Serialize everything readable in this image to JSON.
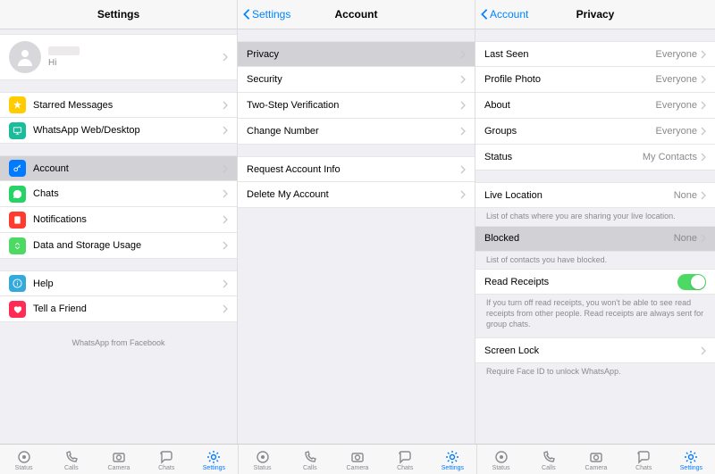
{
  "colors": {
    "accent": "#007aff",
    "whatsapp": "#25d366"
  },
  "tabbar": {
    "items": [
      {
        "label": "Status"
      },
      {
        "label": "Calls"
      },
      {
        "label": "Camera"
      },
      {
        "label": "Chats"
      },
      {
        "label": "Settings"
      }
    ],
    "active_index": 4
  },
  "panel1": {
    "title": "Settings",
    "profile": {
      "status": "Hi"
    },
    "group1": [
      {
        "key": "starred",
        "label": "Starred Messages"
      },
      {
        "key": "webdesktop",
        "label": "WhatsApp Web/Desktop"
      }
    ],
    "group2": [
      {
        "key": "account",
        "label": "Account",
        "selected": true
      },
      {
        "key": "chats",
        "label": "Chats"
      },
      {
        "key": "notifications",
        "label": "Notifications"
      },
      {
        "key": "data",
        "label": "Data and Storage Usage"
      }
    ],
    "group3": [
      {
        "key": "help",
        "label": "Help"
      },
      {
        "key": "tell",
        "label": "Tell a Friend"
      }
    ],
    "brand": "WhatsApp from Facebook"
  },
  "panel2": {
    "back": "Settings",
    "title": "Account",
    "group1": [
      {
        "key": "privacy",
        "label": "Privacy",
        "selected": true
      },
      {
        "key": "security",
        "label": "Security"
      },
      {
        "key": "twostep",
        "label": "Two-Step Verification"
      },
      {
        "key": "changenum",
        "label": "Change Number"
      }
    ],
    "group2": [
      {
        "key": "reqinfo",
        "label": "Request Account Info"
      },
      {
        "key": "delete",
        "label": "Delete My Account"
      }
    ]
  },
  "panel3": {
    "back": "Account",
    "title": "Privacy",
    "group1": [
      {
        "key": "lastseen",
        "label": "Last Seen",
        "value": "Everyone"
      },
      {
        "key": "photo",
        "label": "Profile Photo",
        "value": "Everyone"
      },
      {
        "key": "about",
        "label": "About",
        "value": "Everyone"
      },
      {
        "key": "groups",
        "label": "Groups",
        "value": "Everyone"
      },
      {
        "key": "status",
        "label": "Status",
        "value": "My Contacts"
      }
    ],
    "liveloc": {
      "label": "Live Location",
      "value": "None",
      "footer": "List of chats where you are sharing your live location."
    },
    "blocked": {
      "label": "Blocked",
      "value": "None",
      "footer": "List of contacts you have blocked.",
      "selected": true
    },
    "receipts": {
      "label": "Read Receipts",
      "footer": "If you turn off read receipts, you won't be able to see read receipts from other people. Read receipts are always sent for group chats.",
      "on": true
    },
    "screenlock": {
      "label": "Screen Lock",
      "footer": "Require Face ID to unlock WhatsApp."
    }
  }
}
